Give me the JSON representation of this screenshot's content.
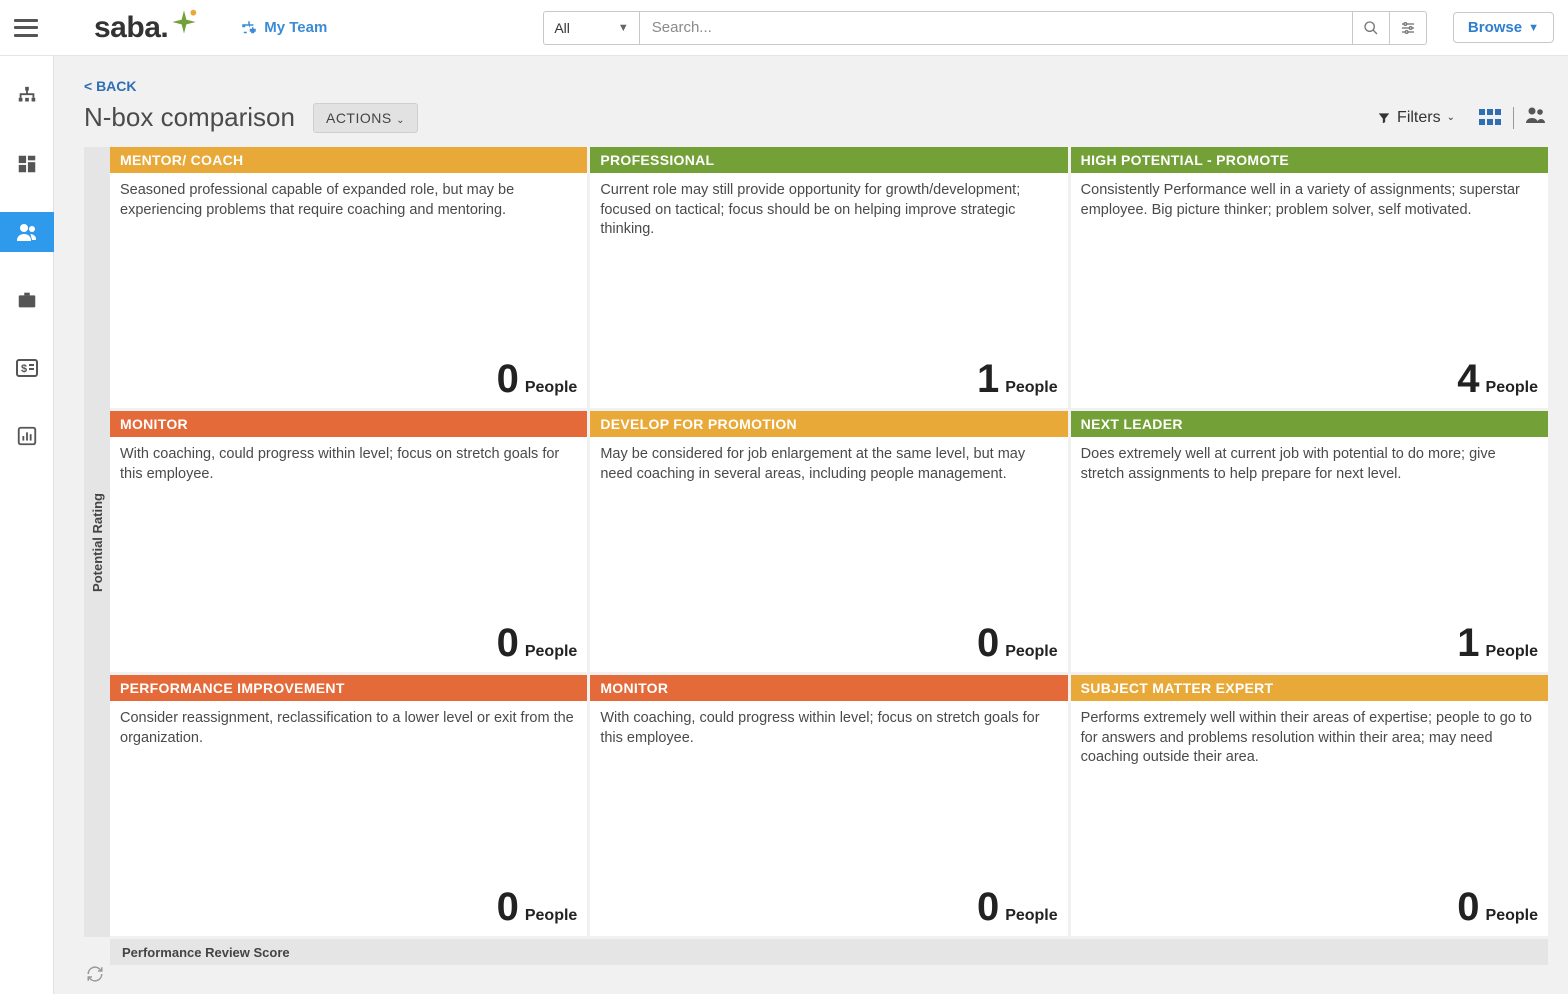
{
  "header": {
    "logo_text": "saba",
    "my_team_label": "My Team",
    "dropdown_all": "All",
    "search_placeholder": "Search...",
    "browse_label": "Browse"
  },
  "page": {
    "back_label": "< BACK",
    "title": "N-box comparison",
    "actions_label": "ACTIONS",
    "filters_label": "Filters",
    "y_axis": "Potential Rating",
    "x_axis": "Performance Review Score"
  },
  "people_label": "People",
  "grid": [
    [
      {
        "title": "MENTOR/ COACH",
        "color": "amber",
        "desc": "Seasoned professional capable of expanded role, but may be experiencing problems that require coaching and mentoring.",
        "count": 0
      },
      {
        "title": "PROFESSIONAL",
        "color": "green",
        "desc": "Current role may still provide opportunity for growth/development; focused on tactical; focus should be on helping improve strategic thinking.",
        "count": 1
      },
      {
        "title": "HIGH POTENTIAL - PROMOTE",
        "color": "green",
        "desc": "Consistently Performance well in a variety of assignments; superstar employee.  Big picture thinker; problem solver, self motivated.",
        "count": 4
      }
    ],
    [
      {
        "title": "MONITOR",
        "color": "orange",
        "desc": "With coaching, could progress within level; focus on stretch goals for this employee.",
        "count": 0
      },
      {
        "title": "DEVELOP FOR PROMOTION",
        "color": "amber",
        "desc": "May be considered for job enlargement at the same level, but may need coaching in several areas, including people management.",
        "count": 0
      },
      {
        "title": "NEXT LEADER",
        "color": "green",
        "desc": "Does extremely well at current job with potential to do more;  give stretch assignments to help prepare for next level.",
        "count": 1
      }
    ],
    [
      {
        "title": "PERFORMANCE IMPROVEMENT",
        "color": "orange",
        "desc": "Consider reassignment, reclassification to a lower level or exit from the organization.",
        "count": 0
      },
      {
        "title": "MONITOR",
        "color": "orange",
        "desc": "With coaching, could progress within level; focus on stretch goals for this employee.",
        "count": 0
      },
      {
        "title": "SUBJECT MATTER EXPERT",
        "color": "amber",
        "desc": "Performs extremely well within their areas of expertise; people to go to for answers and problems resolution within their area; may need coaching outside their area.",
        "count": 0
      }
    ]
  ]
}
